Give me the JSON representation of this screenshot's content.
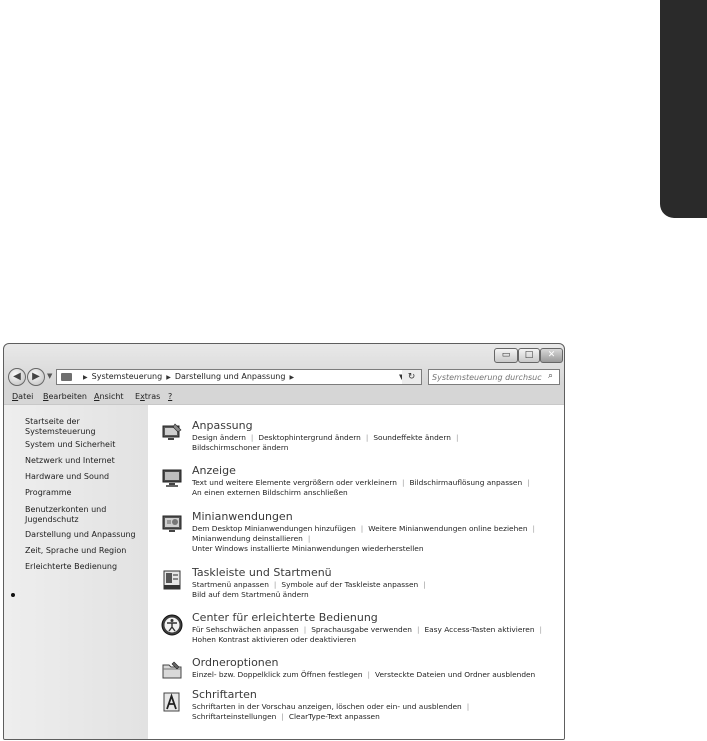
{
  "window": {
    "controls": {
      "minimize": "▭",
      "maximize": "□",
      "close": "✕"
    }
  },
  "navigation": {
    "address_path": [
      "Systemsteuerung",
      "Darstellung und Anpassung"
    ],
    "search_placeholder": "Systemsteuerung durchsuch..."
  },
  "menu": [
    {
      "hotkey": "D",
      "rest": "atei"
    },
    {
      "hotkey": "B",
      "rest": "earbeiten"
    },
    {
      "hotkey": "A",
      "rest": "nsicht"
    },
    {
      "hotkey": "x",
      "pre": "E",
      "rest": "tras"
    },
    {
      "hotkey": "?",
      "rest": ""
    }
  ],
  "sidebar": {
    "items": [
      "Startseite der Systemsteuerung",
      "System und Sicherheit",
      "Netzwerk und Internet",
      "Hardware und Sound",
      "Programme",
      "Benutzerkonten und Jugendschutz",
      "Darstellung und Anpassung",
      "Zeit, Sprache und Region",
      "Erleichterte Bedienung"
    ],
    "active_index": 6
  },
  "categories": [
    {
      "icon": "personalization-icon",
      "title": "Anpassung",
      "lines": [
        [
          "Design ändern",
          "Desktophintergrund ändern",
          "Soundeffekte ändern"
        ],
        [
          "Bildschirmschoner ändern"
        ]
      ]
    },
    {
      "icon": "display-icon",
      "title": "Anzeige",
      "lines": [
        [
          "Text und weitere Elemente vergrößern oder verkleinern",
          "Bildschirmauflösung anpassen"
        ],
        [
          "An einen externen Bildschirm anschließen"
        ]
      ]
    },
    {
      "icon": "gadgets-icon",
      "title": "Minianwendungen",
      "lines": [
        [
          "Dem Desktop Minianwendungen hinzufügen",
          "Weitere Minianwendungen online beziehen"
        ],
        [
          "Minianwendung deinstallieren"
        ],
        [
          "Unter Windows installierte Minianwendungen wiederherstellen"
        ]
      ]
    },
    {
      "icon": "taskbar-icon",
      "title": "Taskleiste und Startmenü",
      "lines": [
        [
          "Startmenü anpassen",
          "Symbole auf der Taskleiste anpassen"
        ],
        [
          "Bild auf dem Startmenü ändern"
        ]
      ]
    },
    {
      "icon": "ease-of-access-icon",
      "title": "Center für erleichterte Bedienung",
      "lines": [
        [
          "Für Sehschwächen anpassen",
          "Sprachausgabe verwenden",
          "Easy Access-Tasten aktivieren"
        ],
        [
          "Hohen Kontrast aktivieren oder deaktivieren"
        ]
      ]
    },
    {
      "icon": "folder-options-icon",
      "title": "Ordneroptionen",
      "lines": [
        [
          "Einzel- bzw. Doppelklick zum Öffnen festlegen",
          "Versteckte Dateien und Ordner ausblenden"
        ]
      ]
    },
    {
      "icon": "fonts-icon",
      "title": "Schriftarten",
      "lines": [
        [
          "Schriftarten in der Vorschau anzeigen, löschen oder ein- und ausblenden"
        ],
        [
          "Schriftarteinstellungen",
          "ClearType-Text anpassen"
        ]
      ]
    }
  ]
}
